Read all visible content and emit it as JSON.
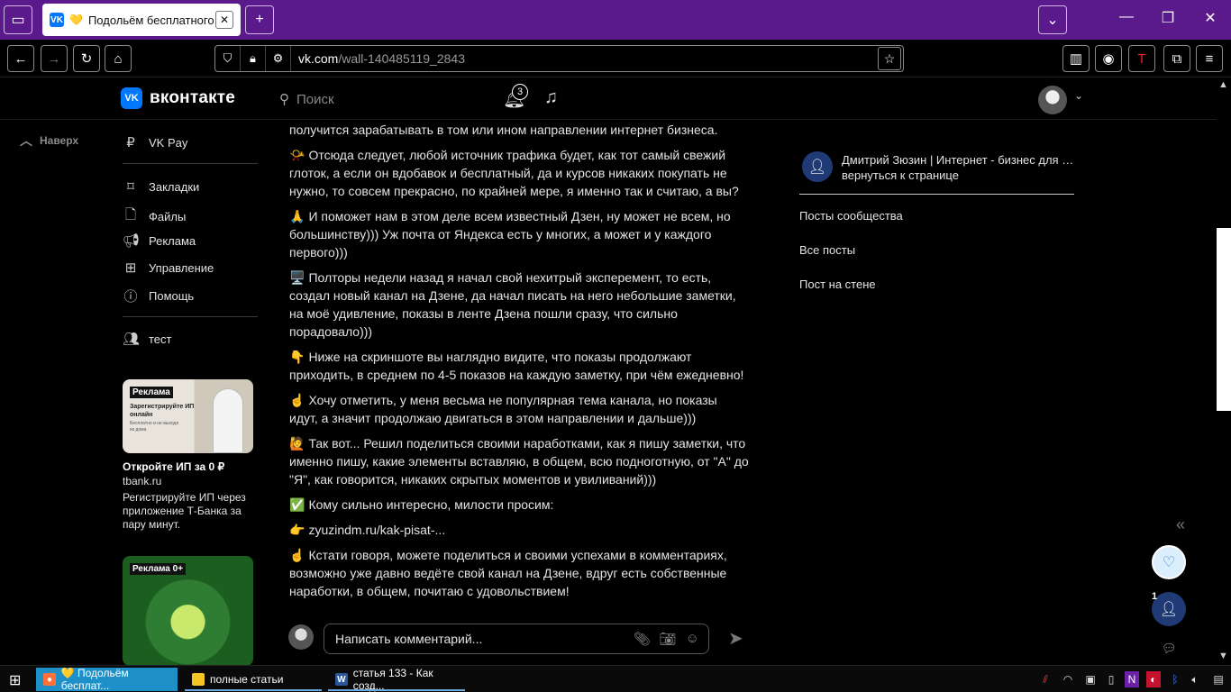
{
  "browser": {
    "tab_title": "Подольём бесплатного тр",
    "tab_heart": "💛",
    "tab_favicon": "VK",
    "url_domain": "vk.com",
    "url_path": "/wall-140485119_2843"
  },
  "vk_header": {
    "logo_text": "вконтакте",
    "search_placeholder": "Поиск",
    "notifications_count": "3"
  },
  "sidebar": {
    "up_label": "Наверх",
    "items": [
      {
        "label": "VK Pay",
        "icon": "ruble-icon"
      },
      {
        "label": "Закладки",
        "icon": "bookmark-icon"
      },
      {
        "label": "Файлы",
        "icon": "file-icon"
      },
      {
        "label": "Реклама",
        "icon": "megaphone-icon"
      },
      {
        "label": "Управление",
        "icon": "grid-icon"
      },
      {
        "label": "Помощь",
        "icon": "help-icon"
      },
      {
        "label": "тест",
        "icon": "users-icon"
      }
    ],
    "ads": [
      {
        "tag": "Реклама",
        "banner_title": "Зарегистрируйте ИП онлайн",
        "banner_sub": "Бесплатно и не выходя из дома",
        "title": "Откройте ИП за 0 ₽",
        "domain": "tbank.ru",
        "desc": "Регистрируйте ИП через приложение Т-Банка за пару минут."
      },
      {
        "tag": "Реклама 0+"
      }
    ]
  },
  "post": {
    "paragraphs": [
      {
        "emoji": "",
        "text": "получится зарабатывать в том или ином направлении интернет бизнеса."
      },
      {
        "emoji": "📯",
        "text": "Отсюда следует, любой источник трафика будет, как тот самый свежий глоток, а если он вдобавок и бесплатный, да и курсов никаких покупать не нужно, то совсем прекрасно, по крайней мере, я именно так и считаю, а вы?"
      },
      {
        "emoji": "🙏",
        "text": "И поможет нам в этом деле всем известный Дзен, ну может не всем, но большинству))) Уж почта от Яндекса есть у многих, а может и у каждого первого)))"
      },
      {
        "emoji": "🖥️",
        "text": "Полторы недели назад я начал свой нехитрый эксперемент, то есть, создал новый канал на Дзене, да начал писать на него небольшие заметки, на моё удивление, показы в ленте Дзена пошли сразу, что сильно порадовало)))"
      },
      {
        "emoji": "👇",
        "text": "Ниже на скриншоте вы наглядно видите, что показы продолжают приходить, в среднем по 4-5 показов на каждую заметку, при чём ежедневно!"
      },
      {
        "emoji": "☝️",
        "text": "Хочу отметить, у меня весьма не популярная тема канала, но показы идут, а значит продолжаю двигаться в этом направлении и дальше)))"
      },
      {
        "emoji": "🙋",
        "text": "Так вот... Решил поделиться своими наработками, как я пишу заметки, что именно пишу, какие элементы вставляю, в общем, всю подноготную, от \"А\" до \"Я\", как говорится, никаких скрытых моментов и увиливаний)))"
      },
      {
        "emoji": "✅",
        "text": "Кому сильно интересно, милости просим:"
      },
      {
        "emoji": "👉",
        "text": "zyuzindm.ru/kak-pisat-..."
      },
      {
        "emoji": "☝️",
        "text": "Кстати говоря, можете поделиться и своими успехами в комментариях, возможно уже давно ведёте свой канал на Дзене, вдруг есть собственные наработки, в общем, почитаю с удовольствием!"
      }
    ],
    "comment_placeholder": "Написать комментарий..."
  },
  "right": {
    "group_name": "Дмитрий Зюзин | Интернет - бизнес для начинающих",
    "back_link": "вернуться к странице",
    "menu": [
      "Посты сообщества",
      "Все посты",
      "Пост на стене"
    ]
  },
  "chats": {
    "unread": "1"
  },
  "taskbar": {
    "tasks": [
      {
        "label": "💛 Подольём бесплат...",
        "icon": "firefox-icon"
      },
      {
        "label": "полные статьи",
        "icon": "folder-icon"
      },
      {
        "label": "статья 133 - Как созд...",
        "icon": "word-icon"
      }
    ]
  },
  "colors": {
    "tabstrip": "#5b1a8c",
    "vk_blue": "#0077ff",
    "background": "#000000",
    "taskbar_active": "#1e90c8"
  }
}
